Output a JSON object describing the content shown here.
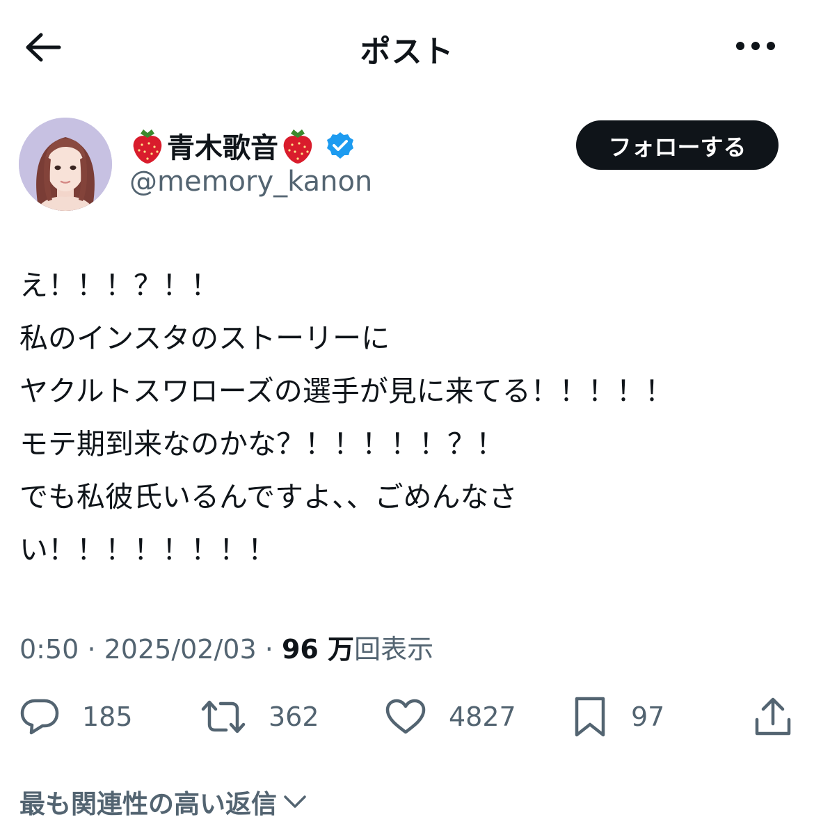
{
  "header": {
    "title": "ポスト",
    "back_icon": "arrow-left-icon",
    "more_icon": "more-horizontal-icon"
  },
  "author": {
    "display_name": "青木歌音",
    "name_emoji": "strawberry-icon",
    "verified_icon": "verified-badge-icon",
    "handle": "@memory_kanon",
    "follow_label": "フォローする"
  },
  "tweet": {
    "lines": [
      "え！！！？！！",
      "私のインスタのストーリーに",
      "ヤクルトスワローズの選手が見に来てる！！！！！",
      "モテ期到来なのかな？！！！！！？！",
      "でも私彼氏いるんですよ、、ごめんなさ",
      "い！！！！！！！！"
    ]
  },
  "meta": {
    "time": "0:50",
    "separator": "·",
    "date": "2025/02/03",
    "views_count": "96 万",
    "views_label": "回表示"
  },
  "actions": {
    "replies": "185",
    "retweets": "362",
    "likes": "4827",
    "bookmarks": "97"
  },
  "replies_sort": {
    "label": "最も関連性の高い返信"
  },
  "colors": {
    "text": "#0f1419",
    "secondary": "#536471",
    "verified": "#1d9bf0",
    "follow_bg": "#0f1419"
  }
}
